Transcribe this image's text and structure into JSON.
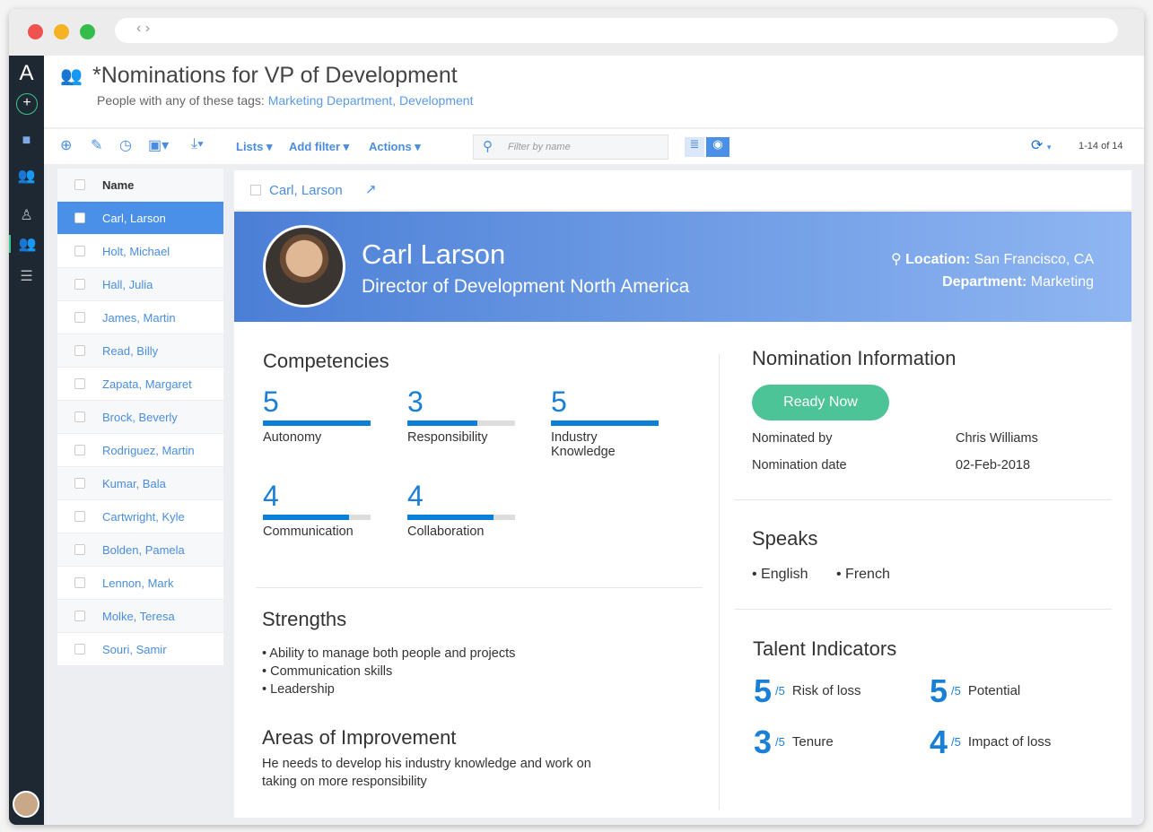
{
  "header": {
    "title": "*Nominations for VP of Development",
    "subtitle_prefix": "People with any of these tags:",
    "tags": "Marketing Department, Development"
  },
  "toolbar": {
    "lists": "Lists",
    "add_filter": "Add filter",
    "actions": "Actions",
    "search_placeholder": "Filter by name",
    "pagination": "1-14 of 14"
  },
  "list": {
    "header": "Name",
    "items": [
      "Carl, Larson",
      "Holt, Michael",
      "Hall, Julia",
      "James, Martin",
      "Read, Billy",
      "Zapata, Margaret",
      "Brock, Beverly",
      "Rodriguez, Martin",
      "Kumar, Bala",
      "Cartwright, Kyle",
      "Bolden, Pamela",
      "Lennon, Mark",
      "Molke, Teresa",
      "Souri, Samir"
    ]
  },
  "detail": {
    "header_name": "Carl, Larson",
    "name": "Carl Larson",
    "role": "Director of Development North America",
    "location_label": "Location:",
    "location": "San Francisco, CA",
    "department_label": "Department:",
    "department": "Marketing",
    "competencies_title": "Competencies",
    "competencies": [
      {
        "value": "5",
        "label": "Autonomy",
        "fraction": 1
      },
      {
        "value": "3",
        "label": "Responsibility",
        "fraction": 0.65
      },
      {
        "value": "5",
        "label": "Industry Knowledge",
        "fraction": 1
      },
      {
        "value": "4",
        "label": "Communication",
        "fraction": 0.8
      },
      {
        "value": "4",
        "label": "Collaboration",
        "fraction": 0.8
      }
    ],
    "strengths_title": "Strengths",
    "strengths": [
      "• Ability to manage both people and projects",
      "• Communication skills",
      "• Leadership"
    ],
    "improvement_title": "Areas of Improvement",
    "improvement": "He needs to develop his industry knowledge and work on taking on more responsibility",
    "nomination_title": "Nomination Information",
    "status": "Ready Now",
    "nominated_by_label": "Nominated by",
    "nominated_by": "Chris Williams",
    "date_label": "Nomination date",
    "date": "02-Feb-2018",
    "speaks_title": "Speaks",
    "languages": [
      "• English",
      "• French"
    ],
    "talent_title": "Talent Indicators",
    "talent": [
      {
        "value": "5",
        "max": "/5",
        "label": "Risk of loss"
      },
      {
        "value": "5",
        "max": "/5",
        "label": "Potential"
      },
      {
        "value": "3",
        "max": "/5",
        "label": "Tenure"
      },
      {
        "value": "4",
        "max": "/5",
        "label": "Impact of loss"
      }
    ]
  }
}
